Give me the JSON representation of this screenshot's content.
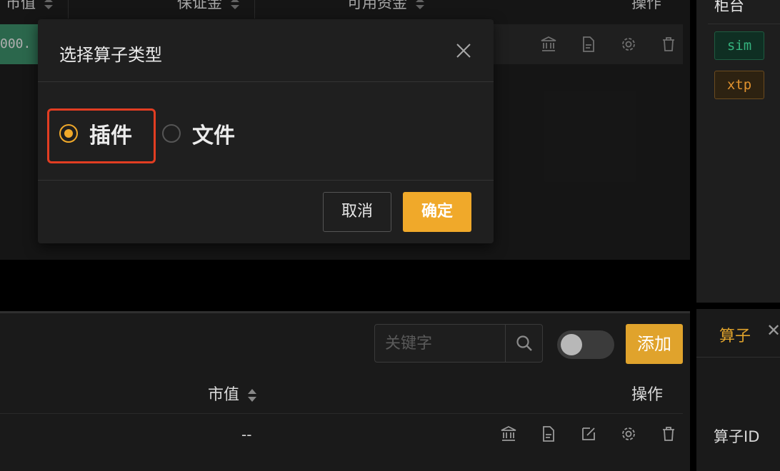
{
  "top_table": {
    "headers": [
      {
        "label": "市值"
      },
      {
        "label": "保证金"
      },
      {
        "label": "可用资金"
      },
      {
        "label": "操作"
      }
    ],
    "row_value": "000.",
    "ops_icons": [
      "bank-icon",
      "document-icon",
      "gear-icon",
      "trash-icon"
    ]
  },
  "right_panel": {
    "header": "柜台",
    "tags": [
      {
        "label": "sim",
        "color": "#35b37e"
      },
      {
        "label": "xtp",
        "color": "#e0922f"
      }
    ]
  },
  "modal": {
    "title": "选择算子类型",
    "options": [
      {
        "label": "插件",
        "checked": true
      },
      {
        "label": "文件",
        "checked": false
      }
    ],
    "cancel_label": "取消",
    "ok_label": "确定",
    "accent": "#f0a92a",
    "highlight_color": "#e23d22"
  },
  "bottom_toolbar": {
    "search_placeholder": "关键字",
    "toggle_on": false,
    "add_label": "添加"
  },
  "bottom_table": {
    "headers": [
      {
        "label": "市值"
      },
      {
        "label": "操作"
      }
    ],
    "row_value": "--",
    "ops_icons": [
      "bank-icon",
      "document-icon",
      "edit-icon",
      "gear-icon",
      "trash-icon"
    ]
  },
  "bottom_right": {
    "tab_label": "算子",
    "field_label": "算子ID"
  }
}
